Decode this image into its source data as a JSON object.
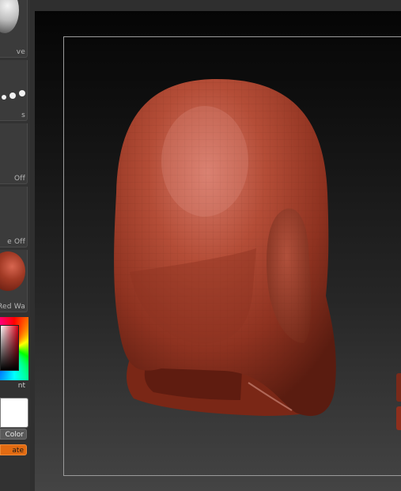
{
  "shelf": {
    "brush_label": "ve",
    "stroke_label": "s",
    "alpha_label": "Off",
    "texture_label": "e Off",
    "material_label": "Red Wa",
    "gradient_label": "nt",
    "switch_color_label": "Color",
    "alternate_label": "ate",
    "main_color": "#ffffff",
    "accent": "#e26b12"
  },
  "viewport": {
    "model": "head-mesh",
    "model_color": "#a33e2b"
  }
}
